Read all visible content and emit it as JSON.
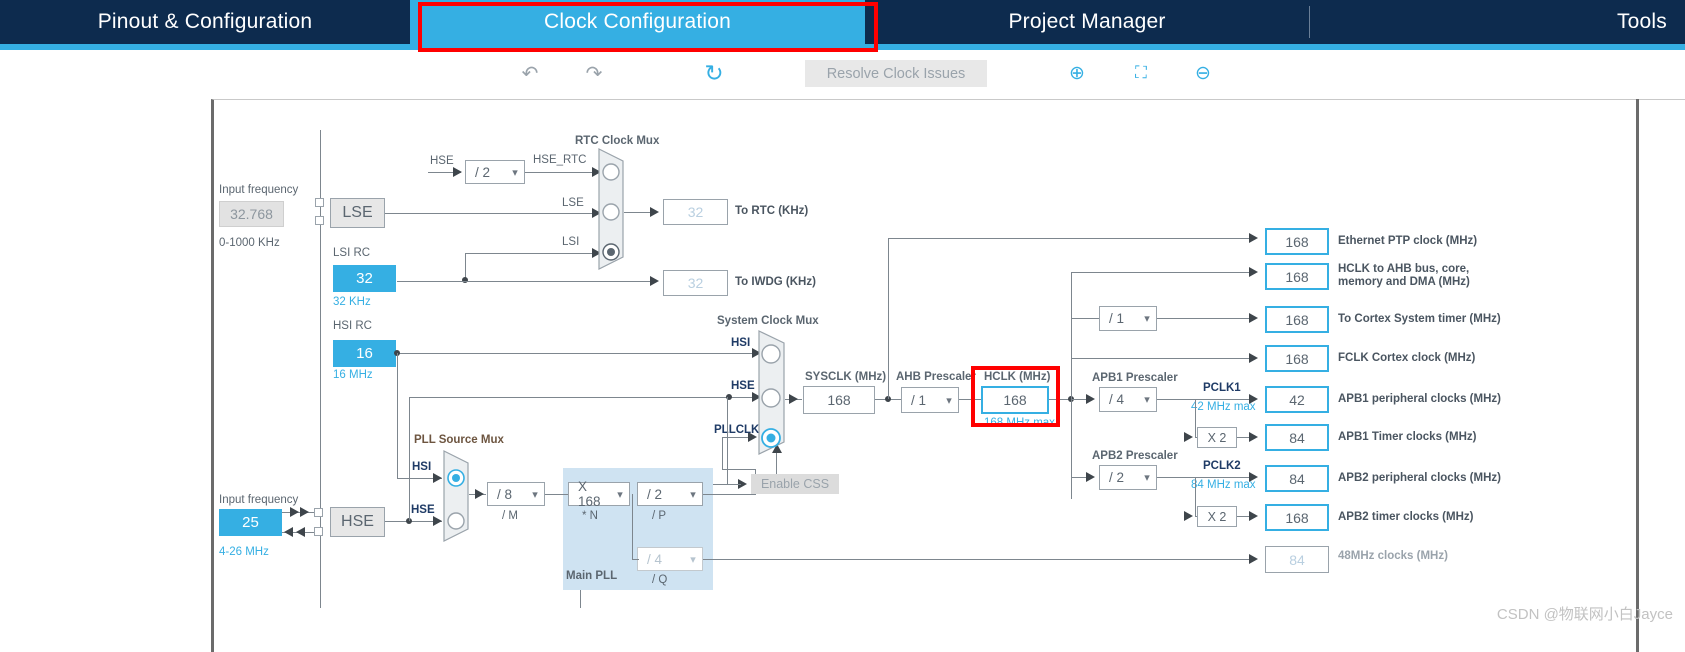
{
  "navbar": {
    "tabs": [
      {
        "id": "pinout",
        "label": "Pinout & Configuration",
        "active": false
      },
      {
        "id": "clock",
        "label": "Clock Configuration",
        "active": true
      },
      {
        "id": "project",
        "label": "Project Manager",
        "active": false
      },
      {
        "id": "tools",
        "label": "Tools",
        "active": false
      }
    ],
    "active_color": "#35afe3",
    "bar_color": "#0d2b4e",
    "highlight_color": "#ff0000"
  },
  "toolbar": {
    "undo": "↶",
    "redo": "↷",
    "reset": "↻",
    "resolve_label": "Resolve Clock Issues",
    "zoom_in": "⊕",
    "fit": "⛶",
    "zoom_out": "⊖"
  },
  "diagram": {
    "lse": {
      "input_frequency_label": "Input frequency",
      "input_value": "32.768",
      "range": "0-1000 KHz",
      "box_label": "LSE"
    },
    "lsi": {
      "title": "LSI RC",
      "value": "32",
      "unit": "32 KHz"
    },
    "hsi": {
      "title": "HSI RC",
      "value": "16",
      "unit": "16 MHz"
    },
    "hse": {
      "input_frequency_label": "Input frequency",
      "input_value": "25",
      "range": "4-26 MHz",
      "box_label": "HSE"
    },
    "rtc_mux": {
      "title": "RTC Clock Mux",
      "inputs": [
        "HSE_RTC",
        "LSE",
        "LSI"
      ],
      "selected": "LSI"
    },
    "hse_rtc_divider": {
      "label": "HSE",
      "value": "/ 2",
      "out_label": "HSE_RTC"
    },
    "to_rtc": {
      "value": "32",
      "label": "To RTC (KHz)"
    },
    "to_iwdg": {
      "value": "32",
      "label": "To IWDG (KHz)"
    },
    "pll_source_mux": {
      "title": "PLL  Source Mux",
      "inputs": [
        "HSI",
        "HSE"
      ],
      "selected": "HSI"
    },
    "pll": {
      "title": "Main PLL",
      "m": {
        "value": "/ 8",
        "caption": "/ M"
      },
      "n": {
        "value": "X 168",
        "caption": "* N"
      },
      "p": {
        "value": "/ 2",
        "caption": "/ P"
      },
      "q": {
        "value": "/ 4",
        "caption": "/ Q"
      }
    },
    "system_clock_mux": {
      "title": "System Clock Mux",
      "inputs": [
        "HSI",
        "HSE",
        "PLLCLK"
      ],
      "selected": "PLLCLK"
    },
    "enable_css": "Enable CSS",
    "sysclk": {
      "title": "SYSCLK (MHz)",
      "value": "168"
    },
    "ahb_prescaler": {
      "title": "AHB Prescaler",
      "value": "/ 1"
    },
    "hclk": {
      "title": "HCLK (MHz)",
      "value": "168",
      "max": "168 MHz max",
      "highlighted": true
    },
    "cortex_divider": {
      "value": "/ 1"
    },
    "apb1_prescaler": {
      "title": "APB1 Prescaler",
      "value": "/ 4",
      "pclk_label": "PCLK1",
      "max": "42 MHz max"
    },
    "apb2_prescaler": {
      "title": "APB2 Prescaler",
      "value": "/ 2",
      "pclk_label": "PCLK2",
      "max": "84 MHz max"
    },
    "apb1_timer_mult": "X 2",
    "apb2_timer_mult": "X 2",
    "outputs": [
      {
        "id": "eth-ptp",
        "value": "168",
        "label": "Ethernet PTP clock (MHz)",
        "dim": false
      },
      {
        "id": "hclk-ahb",
        "value": "168",
        "label": "HCLK to AHB bus, core,\nmemory and DMA (MHz)",
        "label1": "HCLK to AHB bus, core,",
        "label2": "memory and DMA (MHz)",
        "dim": false
      },
      {
        "id": "systimer",
        "value": "168",
        "label": "To Cortex System timer (MHz)",
        "dim": false
      },
      {
        "id": "fclk",
        "value": "168",
        "label": "FCLK Cortex clock (MHz)",
        "dim": false
      },
      {
        "id": "apb1-periph",
        "value": "42",
        "label": "APB1 peripheral clocks (MHz)",
        "dim": false
      },
      {
        "id": "apb1-timer",
        "value": "84",
        "label": "APB1 Timer clocks (MHz)",
        "dim": false
      },
      {
        "id": "apb2-periph",
        "value": "84",
        "label": "APB2 peripheral clocks (MHz)",
        "dim": false
      },
      {
        "id": "apb2-timer",
        "value": "168",
        "label": "APB2 timer clocks (MHz)",
        "dim": false
      },
      {
        "id": "clk48",
        "value": "84",
        "label": "48MHz clocks (MHz)",
        "dim": true
      }
    ]
  },
  "watermark": "CSDN @物联网小白Jayce"
}
